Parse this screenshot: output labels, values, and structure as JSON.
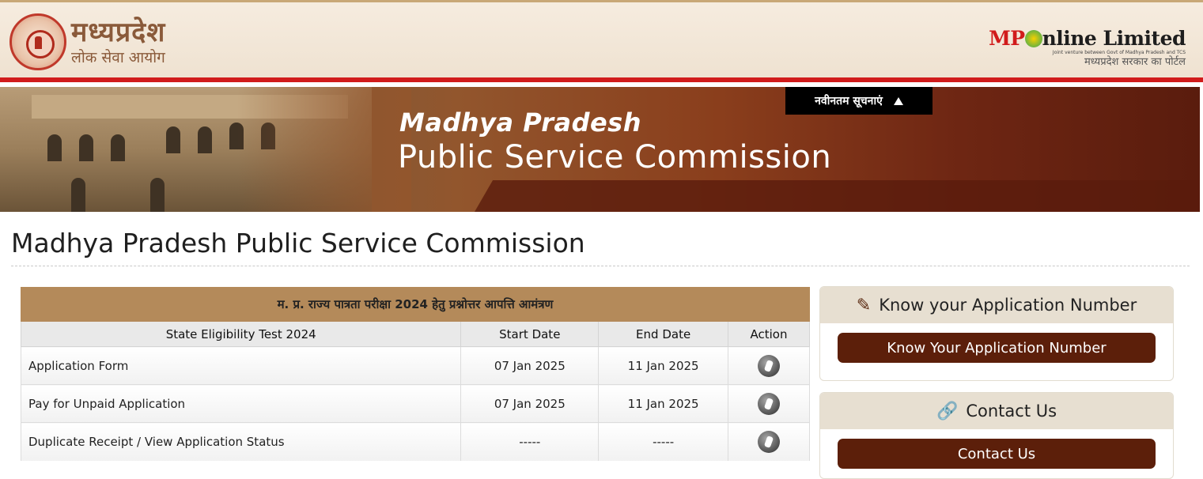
{
  "header": {
    "logo_line1": "मध्यप्रदेश",
    "logo_line2": "लोक सेवा आयोग",
    "mponline_mp": "MP",
    "mponline_rest": "nline Limited",
    "mponline_sub": "Joint venture between Govt of Madhya Pradesh and TCS",
    "mponline_hindi": "मध्यप्रदेश सरकार का पोर्टल"
  },
  "banner": {
    "line1": "Madhya Pradesh",
    "line2": "Public Service Commission",
    "news_label": "नवीनतम सूचनाएं"
  },
  "page": {
    "title": "Madhya Pradesh Public Service Commission"
  },
  "table": {
    "caption": "म. प्र. राज्य पात्रता परीक्षा 2024 हेतु प्रश्नोत्तर आपत्ति आमंत्रण",
    "columns": [
      "State Eligibility Test 2024",
      "Start Date",
      "End Date",
      "Action"
    ],
    "rows": [
      {
        "name": "Application Form",
        "start": "07 Jan 2025",
        "end": "11 Jan 2025"
      },
      {
        "name": "Pay for Unpaid Application",
        "start": "07 Jan 2025",
        "end": "11 Jan 2025"
      },
      {
        "name": "Duplicate Receipt / View Application Status",
        "start": "-----",
        "end": "-----"
      }
    ]
  },
  "sidebar": {
    "know_app": {
      "heading": "Know your Application Number",
      "button": "Know Your Application Number",
      "icon": "edit-icon"
    },
    "contact": {
      "heading": "Contact Us",
      "button": "Contact Us",
      "icon": "link-icon"
    }
  },
  "colors": {
    "header_red": "#d11b1b",
    "table_caption": "#b48a5a",
    "button_brown": "#5c1f0a"
  }
}
